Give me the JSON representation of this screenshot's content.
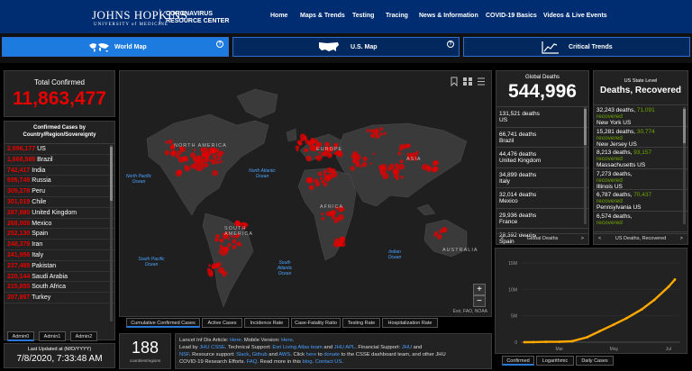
{
  "header": {
    "brand_name": "JOHNS HOPKINS",
    "brand_sub": "UNIVERSITY of MEDICINE",
    "center_line1": "CORONAVIRUS",
    "center_line2": "RESOURCE CENTER",
    "nav": [
      "Home",
      "Maps & Trends",
      "Testing",
      "Tracing",
      "News & Information",
      "COVID-19 Basics",
      "Videos & Live Events"
    ]
  },
  "tabs": [
    {
      "label": "World Map",
      "icon": "world-map-icon"
    },
    {
      "label": "U.S. Map",
      "icon": "us-map-icon"
    },
    {
      "label": "Critical Trends",
      "icon": "trend-chart-icon"
    }
  ],
  "total": {
    "label": "Total Confirmed",
    "value": "11,863,477"
  },
  "confirmed": {
    "title": "Confirmed Cases by Country/Region/Sovereignty",
    "items": [
      {
        "value": "2,996,177",
        "name": "US"
      },
      {
        "value": "1,668,589",
        "name": "Brazil"
      },
      {
        "value": "742,417",
        "name": "India"
      },
      {
        "value": "699,749",
        "name": "Russia"
      },
      {
        "value": "309,278",
        "name": "Peru"
      },
      {
        "value": "301,019",
        "name": "Chile"
      },
      {
        "value": "287,880",
        "name": "United Kingdom"
      },
      {
        "value": "268,008",
        "name": "Mexico"
      },
      {
        "value": "252,130",
        "name": "Spain"
      },
      {
        "value": "248,379",
        "name": "Iran"
      },
      {
        "value": "241,956",
        "name": "Italy"
      },
      {
        "value": "237,489",
        "name": "Pakistan"
      },
      {
        "value": "220,144",
        "name": "Saudi Arabia"
      },
      {
        "value": "215,855",
        "name": "South Africa"
      },
      {
        "value": "207,897",
        "name": "Turkey"
      }
    ],
    "admin_tabs": [
      "Admin0",
      "Admin1",
      "Admin2"
    ]
  },
  "last_updated": {
    "label": "Last Updated at (M/D/YYYY)",
    "value": "7/8/2020, 7:33:48 AM"
  },
  "map": {
    "continents": [
      "NORTH AMERICA",
      "SOUTH AMERICA",
      "EUROPE",
      "ASIA",
      "AFRICA",
      "AUSTRALIA"
    ],
    "oceans": [
      "North Pacific Ocean",
      "North Atlantic Ocean",
      "South Pacific Ocean",
      "South Atlantic Ocean",
      "Indian Ocean"
    ],
    "attribution": "Esri, FAO, NOAA",
    "zoom_in": "+",
    "zoom_out": "−",
    "bottom_tabs": [
      "Cumulative Confirmed Cases",
      "Active Cases",
      "Incidence Rate",
      "Case-Fatality Ratio",
      "Testing Rate",
      "Hospitalization Rate"
    ]
  },
  "countries": {
    "count": "188",
    "label": "countries/regions"
  },
  "info": {
    "line1a": "Lancet Inf Dis Article: ",
    "line1b": "Here",
    "line1c": ". Mobile Version: ",
    "line1d": "Here",
    "line1e": ".",
    "line2a": "Lead by ",
    "line2b": "JHU CSSE",
    "line2c": ". Technical Support: ",
    "line2d": "Esri Living Atlas team",
    "line2e": " and ",
    "line2f": "JHU APL",
    "line2g": ". Financial Support: ",
    "line2h": "JHU",
    "line2i": " and",
    "line3a": "NSF",
    "line3b": ". Resource support: ",
    "line3c": "Slack",
    "line3d": ", ",
    "line3e": "Github",
    "line3f": " and ",
    "line3g": "AWS",
    "line3h": ". Click ",
    "line3i": "here",
    "line3j": " to ",
    "line3k": "donate",
    "line3l": " to the CSSE dashboard team, and other JHU",
    "line4a": "COVID-19 Research Efforts. ",
    "line4b": "FAQ",
    "line4c": ". Read more in this ",
    "line4d": "blog",
    "line4e": ". ",
    "line4f": "Contact US",
    "line4g": "."
  },
  "global_deaths": {
    "title": "Global Deaths",
    "value": "544,996",
    "items": [
      {
        "n": "131,521",
        "unit": "deaths",
        "name": "US"
      },
      {
        "n": "66,741",
        "unit": "deaths",
        "name": "Brazil"
      },
      {
        "n": "44,476",
        "unit": "deaths",
        "name": "United Kingdom"
      },
      {
        "n": "34,899",
        "unit": "deaths",
        "name": "Italy"
      },
      {
        "n": "32,014",
        "unit": "deaths",
        "name": "Mexico"
      },
      {
        "n": "29,936",
        "unit": "deaths",
        "name": "France"
      },
      {
        "n": "28,392",
        "unit": "deaths",
        "name": "Spain"
      }
    ],
    "footer": "Global Deaths"
  },
  "us_state": {
    "title_small": "US State Level",
    "title": "Deaths, Recovered",
    "items": [
      {
        "d": "32,243 deaths,",
        "r": "71,091",
        "rl": "recovered",
        "name": "New York US"
      },
      {
        "d": "15,281 deaths,",
        "r": "30,774",
        "rl": "recovered",
        "name": "New Jersey US"
      },
      {
        "d": "8,213 deaths,",
        "r": "93,157",
        "rl": "recovered",
        "name": "Massachusetts US"
      },
      {
        "d": "7,273 deaths,",
        "r": "",
        "rl": "recovered",
        "name": "Illinois US"
      },
      {
        "d": "6,787 deaths,",
        "r": "70,437",
        "rl": "recovered",
        "name": "Pennsylvania US"
      },
      {
        "d": "6,574 deaths,",
        "r": "",
        "rl": "recovered",
        "name": ""
      }
    ],
    "footer": "US Deaths, Recovered"
  },
  "chart_tabs": [
    "Confirmed",
    "Logarithmic",
    "Daily Cases"
  ],
  "chart_data": {
    "type": "line",
    "title": "",
    "xlabel": "",
    "ylabel": "",
    "y_tick_labels": [
      "0",
      "5M",
      "10M",
      "15M"
    ],
    "x_tick_labels": [
      "Mar",
      "May",
      "Jul"
    ],
    "ylim": [
      0,
      15000000
    ],
    "color": "#ffa800",
    "series": [
      {
        "values": [
          [
            "Jan 22",
            0
          ],
          [
            "Feb 1",
            12000
          ],
          [
            "Feb 15",
            70000
          ],
          [
            "Mar 1",
            88000
          ],
          [
            "Mar 15",
            170000
          ],
          [
            "Apr 1",
            930000
          ],
          [
            "Apr 15",
            2080000
          ],
          [
            "May 1",
            3350000
          ],
          [
            "May 15",
            4540000
          ],
          [
            "Jun 1",
            6200000
          ],
          [
            "Jun 15",
            8000000
          ],
          [
            "Jul 1",
            10500000
          ],
          [
            "Jul 8",
            11863477
          ]
        ]
      }
    ]
  }
}
